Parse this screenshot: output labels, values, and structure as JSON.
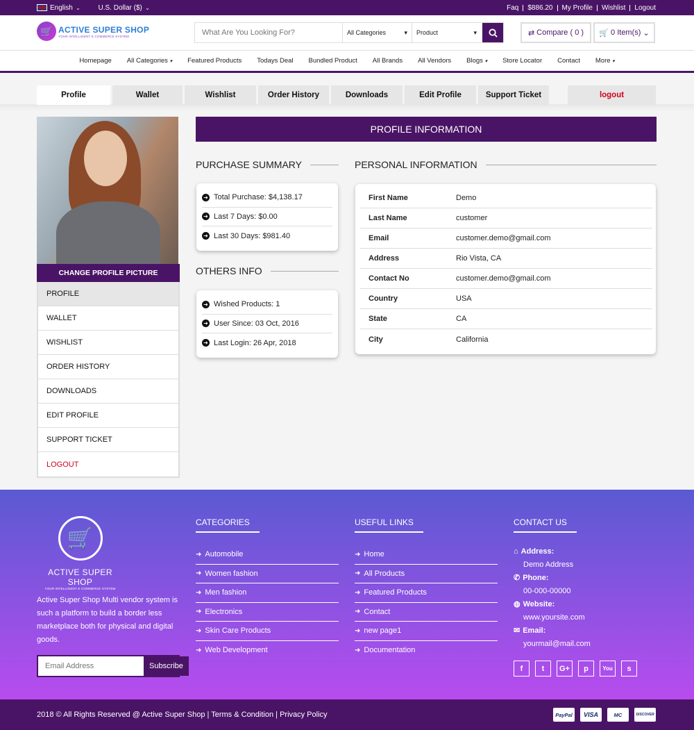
{
  "topbar": {
    "language": "English",
    "currency": "U.S. Dollar ($)",
    "links": [
      "Faq",
      "$886.20",
      "My Profile",
      "Wishlist",
      "Logout"
    ]
  },
  "logo": {
    "title": "ACTIVE SUPER SHOP",
    "subtitle": "YOUR INTELLIGENT E COMMERCE SYSTEM"
  },
  "search": {
    "placeholder": "What Are You Looking For?",
    "category": "All Categories",
    "type": "Product"
  },
  "header": {
    "compare": "Compare ( 0 )",
    "cart": "0 Item(s)"
  },
  "nav": [
    "Homepage",
    "All Categories",
    "Featured Products",
    "Todays Deal",
    "Bundled Product",
    "All Brands",
    "All Vendors",
    "Blogs",
    "Store Locator",
    "Contact",
    "More"
  ],
  "tabs": [
    "Profile",
    "Wallet",
    "Wishlist",
    "Order History",
    "Downloads",
    "Edit Profile",
    "Support Ticket"
  ],
  "tab_logout": "logout",
  "sidebar": {
    "change_picture": "CHANGE PROFILE PICTURE",
    "items": [
      "PROFILE",
      "WALLET",
      "WISHLIST",
      "ORDER HISTORY",
      "DOWNLOADS",
      "EDIT PROFILE",
      "SUPPORT TICKET",
      "LOGOUT"
    ]
  },
  "profile_title": "PROFILE INFORMATION",
  "purchase": {
    "title": "PURCHASE SUMMARY",
    "rows": [
      "Total Purchase: $4,138.17",
      "Last 7 Days: $0.00",
      "Last 30 Days: $981.40"
    ]
  },
  "others": {
    "title": "OTHERS INFO",
    "rows": [
      "Wished Products: 1",
      "User Since: 03 Oct, 2016",
      "Last Login: 26 Apr, 2018"
    ]
  },
  "personal": {
    "title": "PERSONAL INFORMATION",
    "rows": [
      {
        "k": "First Name",
        "v": "Demo"
      },
      {
        "k": "Last Name",
        "v": "customer"
      },
      {
        "k": "Email",
        "v": "customer.demo@gmail.com"
      },
      {
        "k": "Address",
        "v": "Rio Vista, CA"
      },
      {
        "k": "Contact No",
        "v": "customer.demo@gmail.com"
      },
      {
        "k": "Country",
        "v": "USA"
      },
      {
        "k": "State",
        "v": "CA"
      },
      {
        "k": "City",
        "v": "California"
      }
    ]
  },
  "footer": {
    "logo_title": "ACTIVE SUPER SHOP",
    "logo_sub": "YOUR INTELLIGENT E COMMERCE SYSTEM",
    "about": "Active Super Shop Multi vendor system is such a platform to build a border less marketplace both for physical and digital goods.",
    "email_placeholder": "Email Address",
    "subscribe": "Subscribe",
    "categories": {
      "title": "CATEGORIES",
      "items": [
        "Automobile",
        "Women fashion",
        "Men fashion",
        "Electronics",
        "Skin Care Products",
        "Web Development"
      ]
    },
    "links": {
      "title": "USEFUL LINKS",
      "items": [
        "Home",
        "All Products",
        "Featured Products",
        "Contact",
        "new page1",
        "Documentation"
      ]
    },
    "contact": {
      "title": "CONTACT US",
      "address_label": "Address:",
      "address": "Demo Address",
      "phone_label": "Phone:",
      "phone": "00-000-00000",
      "website_label": "Website:",
      "website": "www.yoursite.com",
      "email_label": "Email:",
      "email": "yourmail@mail.com"
    },
    "social": [
      "f",
      "t",
      "G+",
      "p",
      "You",
      "s"
    ]
  },
  "bottom": {
    "copyright": "2018 © All Rights Reserved @ Active Super Shop | Terms & Condition | Privacy Policy",
    "payments": [
      "PayPal",
      "VISA",
      "MC",
      "DISCOVER"
    ]
  }
}
